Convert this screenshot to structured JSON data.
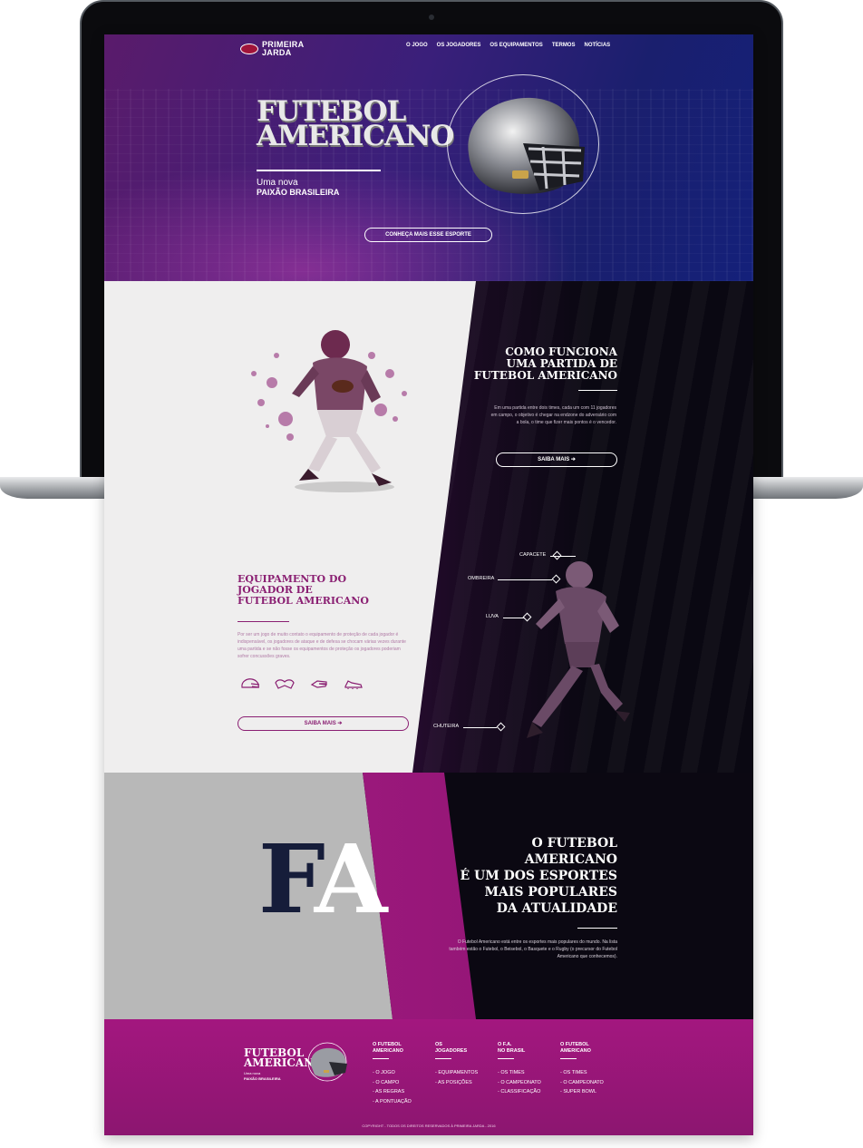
{
  "nav": {
    "logo_line1": "PRIMEIRA",
    "logo_line2": "JARDA",
    "items": [
      "O JOGO",
      "OS JOGADORES",
      "OS EQUIPAMENTOS",
      "TERMOS",
      "NOTÍCIAS"
    ]
  },
  "hero": {
    "title_line1": "FUTEBOL",
    "title_line2": "AMERICANO",
    "subtitle_line1": "Uma nova",
    "subtitle_line2": "PAIXÃO BRASILEIRA",
    "cta": "CONHEÇA MAIS ESSE ESPORTE"
  },
  "how": {
    "title_line1": "COMO FUNCIONA",
    "title_line2": "UMA PARTIDA DE",
    "title_line3": "FUTEBOL AMERICANO",
    "text": "Em uma partida entre dois times, cada um com 11 jogadores em campo, o objetivo é chegar na endzone do adversário com a bola, o time que fizer mais pontos é o vencedor.",
    "button": "SAIBA MAIS ➔"
  },
  "equipment": {
    "title_line1": "EQUIPAMENTO DO",
    "title_line2": "JOGADOR DE",
    "title_line3": "FUTEBOL AMERICANO",
    "text": "Por ser um jogo de muito contato o equipamento de proteção de cada jogador é indispensável, os jogadores de ataque e de defesa se chocam várias vezes durante uma partida e se não fosse os equipamentos de proteção os jogadores poderiam sofrer concussões graves.",
    "button": "SAIBA MAIS ➔",
    "callouts": [
      "CAPACETE",
      "OMBREIRA",
      "LUVA",
      "CHUTEIRA"
    ]
  },
  "fa": {
    "letter1": "F",
    "letter2": "A",
    "title_line1": "O FUTEBOL",
    "title_line2": "AMERICANO",
    "title_line3": "É UM DOS ESPORTES",
    "title_line4": "MAIS POPULARES",
    "title_line5": "DA ATUALIDADE",
    "text": "O Futebol Americano está entre os esportes mais populares do mundo. Na lista também estão o Futebol, o Beisebol, o Basquete e o Rugby (o precursor do Futebol Americano que conhecemos)."
  },
  "footer": {
    "logo_line1": "FUTEBOL",
    "logo_line2": "AMERICANO",
    "sub1": "Uma nova",
    "sub2": "PAIXÃO BRASILEIRA",
    "columns": [
      {
        "title1": "O FUTEBOL",
        "title2": "AMERICANO",
        "links": [
          "- O JOGO",
          "- O CAMPO",
          "- AS REGRAS",
          "- A PONTUAÇÃO"
        ]
      },
      {
        "title1": "OS",
        "title2": "JOGADORES",
        "links": [
          "- EQUIPAMENTOS",
          "- AS POSIÇÕES"
        ]
      },
      {
        "title1": "O F.A.",
        "title2": "NO BRASIL",
        "links": [
          "- OS TIMES",
          "- O CAMPEONATO",
          "- CLASSIFICAÇÃO"
        ]
      },
      {
        "title1": "O FUTEBOL",
        "title2": "AMERICANO",
        "links": [
          "- OS TIMES",
          "- O CAMPEONATO",
          "- SUPER BOWL"
        ]
      }
    ],
    "copyright": "COPYRIGHT - TODOS OS DIREITOS RESERVADOS À PRIMEIRA JARDA - 2016"
  },
  "colors": {
    "accent": "#a3177f",
    "dark": "#0b0812",
    "hero_blue": "#1a1f6e",
    "gray": "#b8b8b8"
  }
}
